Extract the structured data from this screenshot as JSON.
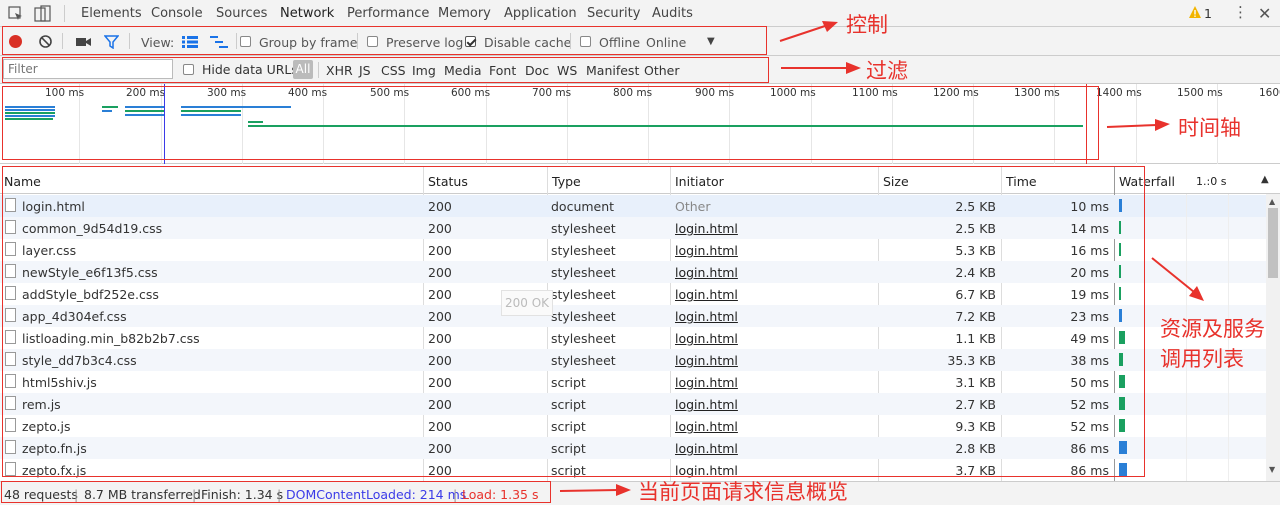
{
  "tabs": [
    "Elements",
    "Console",
    "Sources",
    "Network",
    "Performance",
    "Memory",
    "Application",
    "Security",
    "Audits"
  ],
  "warning_count": "1",
  "controls": {
    "view_label": "View:",
    "group_by_frame": "Group by frame",
    "preserve_log": "Preserve log",
    "disable_cache": "Disable cache",
    "offline": "Offline",
    "throttle": "Online"
  },
  "filter": {
    "placeholder": "Filter",
    "hide_data_urls": "Hide data URLs",
    "types": [
      "All",
      "XHR",
      "JS",
      "CSS",
      "Img",
      "Media",
      "Font",
      "Doc",
      "WS",
      "Manifest",
      "Other"
    ]
  },
  "timeline_ticks": [
    "100 ms",
    "200 ms",
    "300 ms",
    "400 ms",
    "500 ms",
    "600 ms",
    "700 ms",
    "800 ms",
    "900 ms",
    "1000 ms",
    "1100 ms",
    "1200 ms",
    "1300 ms",
    "1400 ms",
    "1500 ms",
    "1600"
  ],
  "columns": {
    "name": "Name",
    "status": "Status",
    "type": "Type",
    "initiator": "Initiator",
    "size": "Size",
    "time": "Time",
    "waterfall": "Waterfall",
    "waterfall_scale": "1.:0 s"
  },
  "tooltip": "200 OK",
  "requests": [
    {
      "name": "login.html",
      "status": "200",
      "type": "document",
      "initiator": "Other",
      "size": "2.5 KB",
      "time": "10 ms"
    },
    {
      "name": "common_9d54d19.css",
      "status": "200",
      "type": "stylesheet",
      "initiator": "login.html",
      "size": "2.5 KB",
      "time": "14 ms"
    },
    {
      "name": "layer.css",
      "status": "200",
      "type": "stylesheet",
      "initiator": "login.html",
      "size": "5.3 KB",
      "time": "16 ms"
    },
    {
      "name": "newStyle_e6f13f5.css",
      "status": "200",
      "type": "stylesheet",
      "initiator": "login.html",
      "size": "2.4 KB",
      "time": "20 ms"
    },
    {
      "name": "addStyle_bdf252e.css",
      "status": "200",
      "type": "stylesheet",
      "initiator": "login.html",
      "size": "6.7 KB",
      "time": "19 ms"
    },
    {
      "name": "app_4d304ef.css",
      "status": "200",
      "type": "stylesheet",
      "initiator": "login.html",
      "size": "7.2 KB",
      "time": "23 ms"
    },
    {
      "name": "listloading.min_b82b2b7.css",
      "status": "200",
      "type": "stylesheet",
      "initiator": "login.html",
      "size": "1.1 KB",
      "time": "49 ms"
    },
    {
      "name": "style_dd7b3c4.css",
      "status": "200",
      "type": "stylesheet",
      "initiator": "login.html",
      "size": "35.3 KB",
      "time": "38 ms"
    },
    {
      "name": "html5shiv.js",
      "status": "200",
      "type": "script",
      "initiator": "login.html",
      "size": "3.1 KB",
      "time": "50 ms"
    },
    {
      "name": "rem.js",
      "status": "200",
      "type": "script",
      "initiator": "login.html",
      "size": "2.7 KB",
      "time": "52 ms"
    },
    {
      "name": "zepto.js",
      "status": "200",
      "type": "script",
      "initiator": "login.html",
      "size": "9.3 KB",
      "time": "52 ms"
    },
    {
      "name": "zepto.fn.js",
      "status": "200",
      "type": "script",
      "initiator": "login.html",
      "size": "2.8 KB",
      "time": "86 ms"
    },
    {
      "name": "zepto.fx.js",
      "status": "200",
      "type": "script",
      "initiator": "login.html",
      "size": "3.7 KB",
      "time": "86 ms"
    }
  ],
  "status_bar": {
    "requests": "48 requests",
    "transferred": "8.7 MB transferred",
    "finish": "Finish: 1.34 s",
    "dom_loaded": "DOMContentLoaded: 214 ms",
    "load": "Load: 1.35 s"
  },
  "annotations": {
    "control": "控制",
    "filter": "过滤",
    "timeline": "时间轴",
    "list_line1": "资源及服务",
    "list_line2": "调用列表",
    "summary": "当前页面请求信息概览"
  },
  "colors": {
    "accent": "#1a73e8",
    "annotation": "#e8322c",
    "record": "#d93025",
    "dom_loaded": "#3b3be8",
    "load": "#e8322c"
  }
}
